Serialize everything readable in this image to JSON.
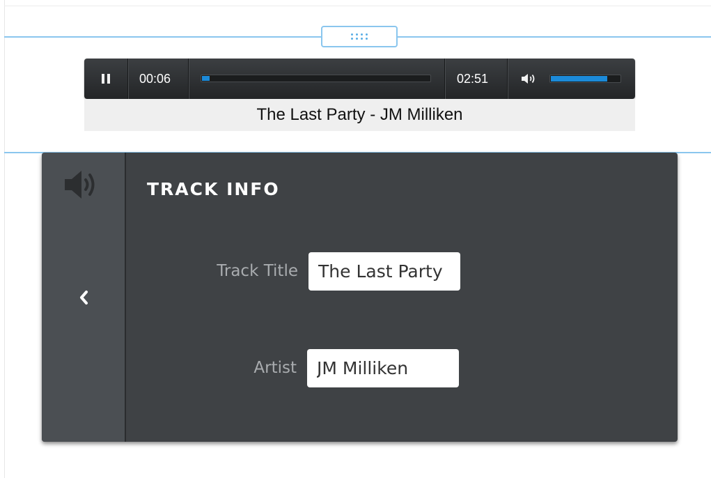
{
  "player": {
    "current_time": "00:06",
    "total_time": "02:51",
    "progress": 0.035,
    "volume": 0.82,
    "pause_icon": "pause-icon",
    "volume_icon": "speaker-icon",
    "now_playing": "The Last Party - JM Milliken"
  },
  "panel": {
    "title": "TRACK INFO",
    "sidebar_icon": "speaker-icon",
    "back_icon": "chevron-left-icon",
    "fields": {
      "track_title": {
        "label": "Track Title",
        "value": "The Last Party"
      },
      "artist": {
        "label": "Artist",
        "value": "JM Milliken"
      }
    }
  },
  "colors": {
    "accent": "#1c8ad8",
    "guide": "#8ac6ee",
    "panel_bg": "#3f4245",
    "sidebar_bg": "#4b4f53"
  }
}
